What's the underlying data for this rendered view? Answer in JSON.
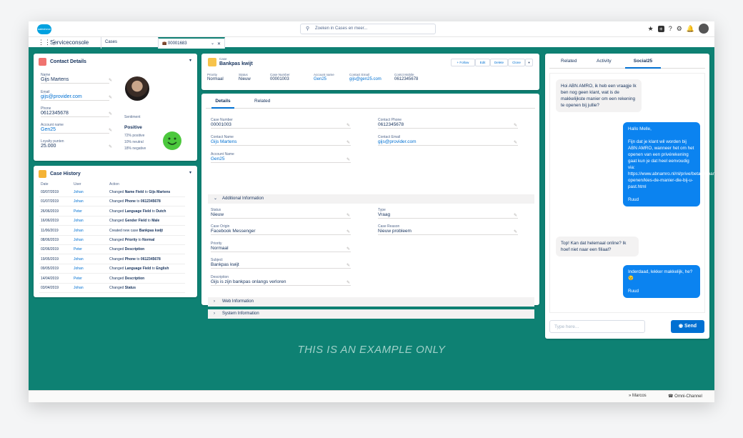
{
  "topbar": {
    "logo": "salesforce",
    "search_placeholder": "Zoeken in Cases en meer...",
    "icons": [
      "star-icon",
      "add-icon",
      "help-icon",
      "gear-icon",
      "bell-icon",
      "avatar"
    ]
  },
  "nav": {
    "app_name": "Serviceconsole",
    "tabs": [
      {
        "label": "Cases"
      },
      {
        "label": "00001683"
      }
    ]
  },
  "contact": {
    "title": "Contact Details",
    "fields": [
      {
        "label": "Name",
        "value": "Gijs Martens",
        "link": false
      },
      {
        "label": "Email",
        "value": "gijs@provider.com",
        "link": true
      },
      {
        "label": "Phone",
        "value": "0612345678",
        "link": false
      },
      {
        "label": "Account name",
        "value": "Gen25",
        "link": true
      },
      {
        "label": "Loyalty punten",
        "value": "25.000",
        "link": false
      }
    ],
    "sentiment": {
      "label": "Sentiment",
      "value": "Positive",
      "lines": [
        "72% positive",
        "10% neutral",
        "18% negative"
      ]
    }
  },
  "history": {
    "title": "Case History",
    "headers": [
      "Date",
      "User",
      "Action"
    ],
    "rows": [
      {
        "date": "03/07/2019",
        "user": "Johan",
        "pre": "Changed",
        "field": "Name Field",
        "mid": "to",
        "val": "Gijs Martens"
      },
      {
        "date": "01/07/2019",
        "user": "Johan",
        "pre": "Changed",
        "field": "Phone",
        "mid": "to",
        "val": "0612345678"
      },
      {
        "date": "26/06/2019",
        "user": "Peter",
        "pre": "Changed",
        "field": "Language Field",
        "mid": "to",
        "val": "Dutch"
      },
      {
        "date": "16/06/2019",
        "user": "Johan",
        "pre": "Changed",
        "field": "Gender Field",
        "mid": "to",
        "val": "Male"
      },
      {
        "date": "11/06/2019",
        "user": "Johan",
        "pre": "Created new case",
        "field": "Bankpas kwijt",
        "mid": "",
        "val": ""
      },
      {
        "date": "08/06/2019",
        "user": "Johan",
        "pre": "Changed",
        "field": "Priority",
        "mid": "to",
        "val": "Normal"
      },
      {
        "date": "02/06/2019",
        "user": "Peter",
        "pre": "Changed",
        "field": "Description",
        "mid": "",
        "val": ""
      },
      {
        "date": "19/05/2019",
        "user": "Johan",
        "pre": "Changed",
        "field": "Phone",
        "mid": "to",
        "val": "0612345678"
      },
      {
        "date": "09/05/2019",
        "user": "Johan",
        "pre": "Changed",
        "field": "Language Field",
        "mid": "to",
        "val": "English"
      },
      {
        "date": "14/04/2019",
        "user": "Peter",
        "pre": "Changed",
        "field": "Description",
        "mid": "",
        "val": ""
      },
      {
        "date": "03/04/2019",
        "user": "Johan",
        "pre": "Changed",
        "field": "Status",
        "mid": "",
        "val": ""
      }
    ]
  },
  "case": {
    "type_label": "Case",
    "title": "Bankpas kwijt",
    "buttons": [
      "+ Follow",
      "Edit",
      "Delete",
      "Clone"
    ],
    "highlights": [
      {
        "label": "Priority",
        "value": "Normaal",
        "link": false
      },
      {
        "label": "Status",
        "value": "Nieuw",
        "link": false
      },
      {
        "label": "Case Number",
        "value": "00001003",
        "link": false
      },
      {
        "label": "Account name",
        "value": "Gen25",
        "link": true
      },
      {
        "label": "Contact Email",
        "value": "gijs@gen25.com",
        "link": true
      },
      {
        "label": "Contct Mobile",
        "value": "0612345678",
        "link": false
      }
    ],
    "tabs": [
      "Details",
      "Related"
    ],
    "details_left": [
      {
        "label": "Case Number",
        "value": "00001003",
        "link": false
      },
      {
        "label": "Contact Name",
        "value": "Gijs Martens",
        "link": true
      },
      {
        "label": "Account Name",
        "value": "Gen25",
        "link": true
      }
    ],
    "details_right": [
      {
        "label": "Contact Phone",
        "value": "0612345678",
        "link": false
      },
      {
        "label": "Contact Email",
        "value": "gijs@provider.com",
        "link": true
      }
    ],
    "section_additional": "Additional Information",
    "additional_left": [
      {
        "label": "Status",
        "value": "Nieuw"
      },
      {
        "label": "Case Origin",
        "value": "Facebook Messenger"
      },
      {
        "label": "Priority",
        "value": "Normaal"
      },
      {
        "label": "Subject",
        "value": "Bankpas kwijt"
      },
      {
        "label": "Description",
        "value": "Gijs is zijn bankpas onlangs verloren"
      }
    ],
    "additional_right": [
      {
        "label": "Type",
        "value": "Vraag"
      },
      {
        "label": "Case Reason",
        "value": "Nieuw probleem"
      }
    ],
    "section_web": "Web Information",
    "section_system": "System Information"
  },
  "chat": {
    "tabs": [
      "Related",
      "Activity",
      "Social25"
    ],
    "messages": [
      {
        "dir": "in",
        "text": "Hoi ABN AMRO, ik heb een vraagje Ik ben nog geen klant, wat is de makkelijkste manier om een rekening te openen bij jullie?"
      },
      {
        "dir": "out",
        "text": "Hallo Melle,\n\nFijn dat je klant wil worden bij ABN AMRO, wanneer het om het openen van een privérekening gaat kun je dat heel eenvoudig via: https://www.abnamro.nl/nl/prive/betalen/bankrekening-openen/kies-de-manier-die-bij-u-past.html\n\nRuud"
      },
      {
        "dir": "in",
        "text": "Top! Kan dat helemaal online? Ik hoef niet naar een filiaal?"
      },
      {
        "dir": "out",
        "text": "Inderdaad, lekker makkelijk, he? 😉\n\nRuud"
      }
    ],
    "input_placeholder": "Type here...",
    "send_label": "Send"
  },
  "watermark": "THIS IS AN EXAMPLE ONLY",
  "statusbar": {
    "user": "Marcos",
    "omni": "Omni-Channel"
  },
  "colors": {
    "teal": "#0e8173",
    "link": "#0070d2",
    "bubble_out": "#0b83f0",
    "contact_icon": "#f0736f",
    "history_icon": "#f5b335",
    "case_icon": "#f7c34b"
  }
}
